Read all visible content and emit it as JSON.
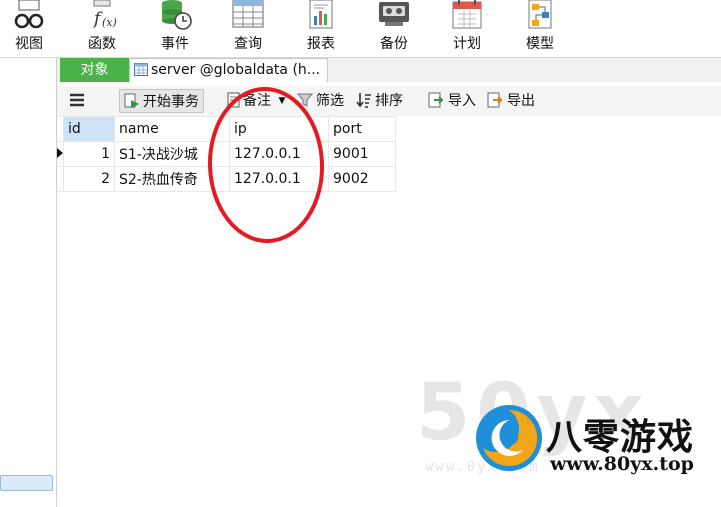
{
  "ribbon": {
    "items": [
      {
        "label": "视图",
        "icon": "glasses-icon"
      },
      {
        "label": "函数",
        "icon": "function-icon"
      },
      {
        "label": "事件",
        "icon": "event-icon"
      },
      {
        "label": "查询",
        "icon": "query-icon"
      },
      {
        "label": "报表",
        "icon": "report-icon"
      },
      {
        "label": "备份",
        "icon": "backup-icon"
      },
      {
        "label": "计划",
        "icon": "schedule-icon"
      },
      {
        "label": "模型",
        "icon": "model-icon"
      }
    ]
  },
  "tabs": {
    "objects_label": "对象",
    "active_tab_label": "server @globaldata (h..."
  },
  "toolbar": {
    "begin_transaction": "开始事务",
    "note": "备注",
    "filter": "筛选",
    "sort": "排序",
    "import": "导入",
    "export": "导出"
  },
  "table": {
    "columns": [
      "id",
      "name",
      "ip",
      "port"
    ],
    "rows": [
      {
        "id": "1",
        "name": "S1-决战沙城",
        "ip": "127.0.0.1",
        "port": "9001"
      },
      {
        "id": "2",
        "name": "S2-热血传奇",
        "ip": "127.0.0.1",
        "port": "9002"
      }
    ]
  },
  "watermark": {
    "brand": "八零游戏",
    "site": "www.80yx.top",
    "faint_text": "50yx",
    "faint_sub": "www.0yx.com"
  },
  "colors": {
    "tab_green": "#4db14a",
    "annotation_red": "#e31b23",
    "logo_blue": "#1e8fd8",
    "logo_orange": "#f2a516"
  }
}
